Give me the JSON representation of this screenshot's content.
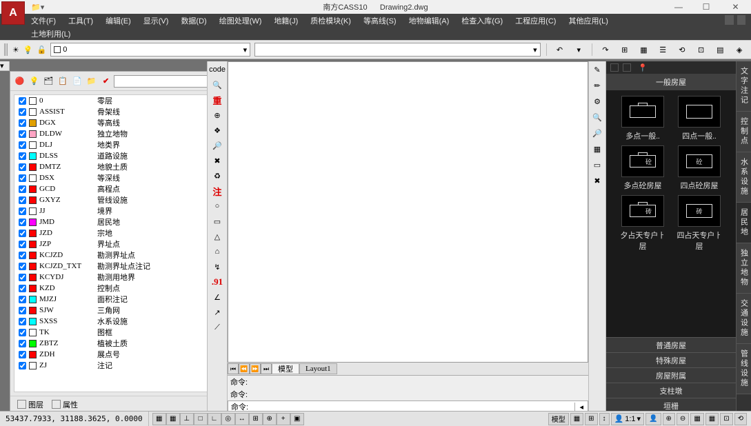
{
  "title": {
    "app": "南方CASS10",
    "file": "Drawing2.dwg"
  },
  "menus": [
    "文件(F)",
    "工具(T)",
    "编辑(E)",
    "显示(V)",
    "数据(D)",
    "绘图处理(W)",
    "地籍(J)",
    "质检模块(K)",
    "等高线(S)",
    "地物编辑(A)",
    "检查入库(G)",
    "工程应用(C)",
    "其他应用(L)"
  ],
  "menus2": [
    "土地利用(L)"
  ],
  "layerCombo": {
    "name": "0"
  },
  "layerTabs": {
    "tab1": "图层",
    "tab2": "属性"
  },
  "layers": [
    {
      "c": "#ffffff",
      "n": "0",
      "d": "零层"
    },
    {
      "c": "#ffffff",
      "n": "ASSIST",
      "d": "骨架线"
    },
    {
      "c": "#e0a000",
      "n": "DGX",
      "d": "等高线"
    },
    {
      "c": "#ffa4c4",
      "n": "DLDW",
      "d": "独立地物"
    },
    {
      "c": "#ffffff",
      "n": "DLJ",
      "d": "地类界"
    },
    {
      "c": "#00ffff",
      "n": "DLSS",
      "d": "道路设施"
    },
    {
      "c": "#ff0000",
      "n": "DMTZ",
      "d": "地貌土质"
    },
    {
      "c": "#ffffff",
      "n": "DSX",
      "d": "等深线"
    },
    {
      "c": "#ff0000",
      "n": "GCD",
      "d": "高程点"
    },
    {
      "c": "#ff0000",
      "n": "GXYZ",
      "d": "管线设施"
    },
    {
      "c": "#ffffff",
      "n": "JJ",
      "d": "境界"
    },
    {
      "c": "#ff00ff",
      "n": "JMD",
      "d": "居民地"
    },
    {
      "c": "#ff0000",
      "n": "JZD",
      "d": "宗地"
    },
    {
      "c": "#ff0000",
      "n": "JZP",
      "d": "界址点"
    },
    {
      "c": "#ff0000",
      "n": "KCJZD",
      "d": "勘测界址点"
    },
    {
      "c": "#ff0000",
      "n": "KCJZD_TXT",
      "d": "勘测界址点注记"
    },
    {
      "c": "#ff0000",
      "n": "KCYDJ",
      "d": "勘测用地界"
    },
    {
      "c": "#ff0000",
      "n": "KZD",
      "d": "控制点"
    },
    {
      "c": "#00ffff",
      "n": "MJZJ",
      "d": "面积注记"
    },
    {
      "c": "#ff0000",
      "n": "SJW",
      "d": "三角网"
    },
    {
      "c": "#00ffff",
      "n": "SXSS",
      "d": "水系设施"
    },
    {
      "c": "#ffffff",
      "n": "TK",
      "d": "图框"
    },
    {
      "c": "#00ff00",
      "n": "ZBTZ",
      "d": "植被土质"
    },
    {
      "c": "#ff0000",
      "n": "ZDH",
      "d": "展点号"
    },
    {
      "c": "#ffffff",
      "n": "ZJ",
      "d": "注记"
    }
  ],
  "vToolbar": [
    {
      "t": "code",
      "cls": ""
    },
    {
      "t": "🔍",
      "cls": ""
    },
    {
      "t": "重",
      "cls": "red"
    },
    {
      "t": "⊕",
      "cls": ""
    },
    {
      "t": "❖",
      "cls": ""
    },
    {
      "t": "🔎",
      "cls": ""
    },
    {
      "t": "✖",
      "cls": ""
    },
    {
      "t": "♻",
      "cls": ""
    },
    {
      "t": "注",
      "cls": "red"
    },
    {
      "t": "○",
      "cls": ""
    },
    {
      "t": "▭",
      "cls": ""
    },
    {
      "t": "△",
      "cls": ""
    },
    {
      "t": "⌂",
      "cls": ""
    },
    {
      "t": "↯",
      "cls": ""
    },
    {
      "t": ".91",
      "cls": "red"
    },
    {
      "t": "∠",
      "cls": ""
    },
    {
      "t": "↗",
      "cls": ""
    },
    {
      "t": "⟋",
      "cls": ""
    }
  ],
  "rightBar": [
    "✎",
    "✏",
    "⚙",
    "🔍",
    "🔎",
    "▦",
    "▭",
    "✖"
  ],
  "modelTabs": {
    "nav": [
      "⏮",
      "⏪",
      "⏩",
      "⏭"
    ],
    "tab1": "模型",
    "tab2": "Layout1"
  },
  "cmd": {
    "label": "命令:",
    "history1": "命令:",
    "history2": "命令:"
  },
  "palette": {
    "header": "一般房屋",
    "items": [
      {
        "l": "多点一般..",
        "txt": ""
      },
      {
        "l": "四点一般..",
        "txt": ""
      },
      {
        "l": "多点砼房屋",
        "txt": "砼"
      },
      {
        "l": "四点砼房屋",
        "txt": "砼"
      },
      {
        "l": "夕占天专户ㅏ层",
        "txt": "砖"
      },
      {
        "l": "四占天专户ㅏ层",
        "txt": "砖"
      }
    ],
    "folds": [
      "普通房屋",
      "特殊房屋",
      "房屋附属",
      "支柱墩",
      "垣栅"
    ]
  },
  "sideTabs": [
    "文字注记",
    "控制点",
    "水系设施",
    "居民地",
    "独立地物",
    "交通设施",
    "管线设施"
  ],
  "status": {
    "coords": "53437.7933, 31188.3625, 0.0000",
    "btns": [
      "▦",
      "▦",
      "⊥",
      "□",
      "∟",
      "◎",
      "↔",
      "⊞",
      "⊕",
      "+",
      "▣"
    ],
    "model": "模型",
    "scale": "1:1",
    "rbtns": [
      "▦",
      "⊞",
      "↕",
      "👤",
      "⊕",
      "⊖",
      "▦",
      "▦",
      "⊡",
      "⟲"
    ]
  }
}
